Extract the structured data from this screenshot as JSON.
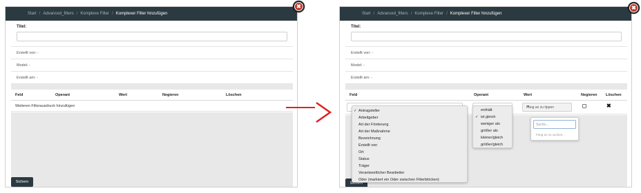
{
  "breadcrumb": {
    "items": [
      "Start",
      "Advanced_filters",
      "Komplexe Filter"
    ],
    "separator": "/",
    "active": "Komplexer Filter hinzufügen"
  },
  "form": {
    "title_label": "Titel:",
    "title_value": "",
    "created_by": "Erstellt von: -",
    "model": "Model: -",
    "created_at": "Erstellt am: -"
  },
  "table": {
    "headers": {
      "field": "Feld",
      "operant": "Operant",
      "value": "Wert",
      "negate": "Negieren",
      "delete": "Löschen"
    },
    "add_row_label": "Weiteren Filterausdruck hinzufügen"
  },
  "save_label": "Sichern",
  "close_glyph": "✖",
  "field_dropdown": {
    "options": [
      "Antragsteller",
      "Arbeitgeber",
      "Art der Förderung",
      "Art der Maßnahme",
      "Bezeichnung",
      "Erstellt von",
      "Ort",
      "Status",
      "Träger",
      "Verantwortlicher Bearbeiter",
      "Oder (markiert ein Oder zwischen Filterblöcken)"
    ],
    "selected_index": 0
  },
  "operant_dropdown": {
    "options": [
      "enthält",
      "ist gleich",
      "weniger als",
      "größer als",
      "kleiner/gleich",
      "größer/gleich"
    ],
    "selected_index": 1
  },
  "value_select": {
    "placeholder": "Fang an zu tippen",
    "search_placeholder": "Suche...",
    "hint": "Fang an zu suchen..."
  },
  "colors": {
    "header_bar": "#2b3a41",
    "close_red": "#c0392b",
    "arrow_red": "#e02020",
    "gray_area": "#e8e8e8"
  }
}
